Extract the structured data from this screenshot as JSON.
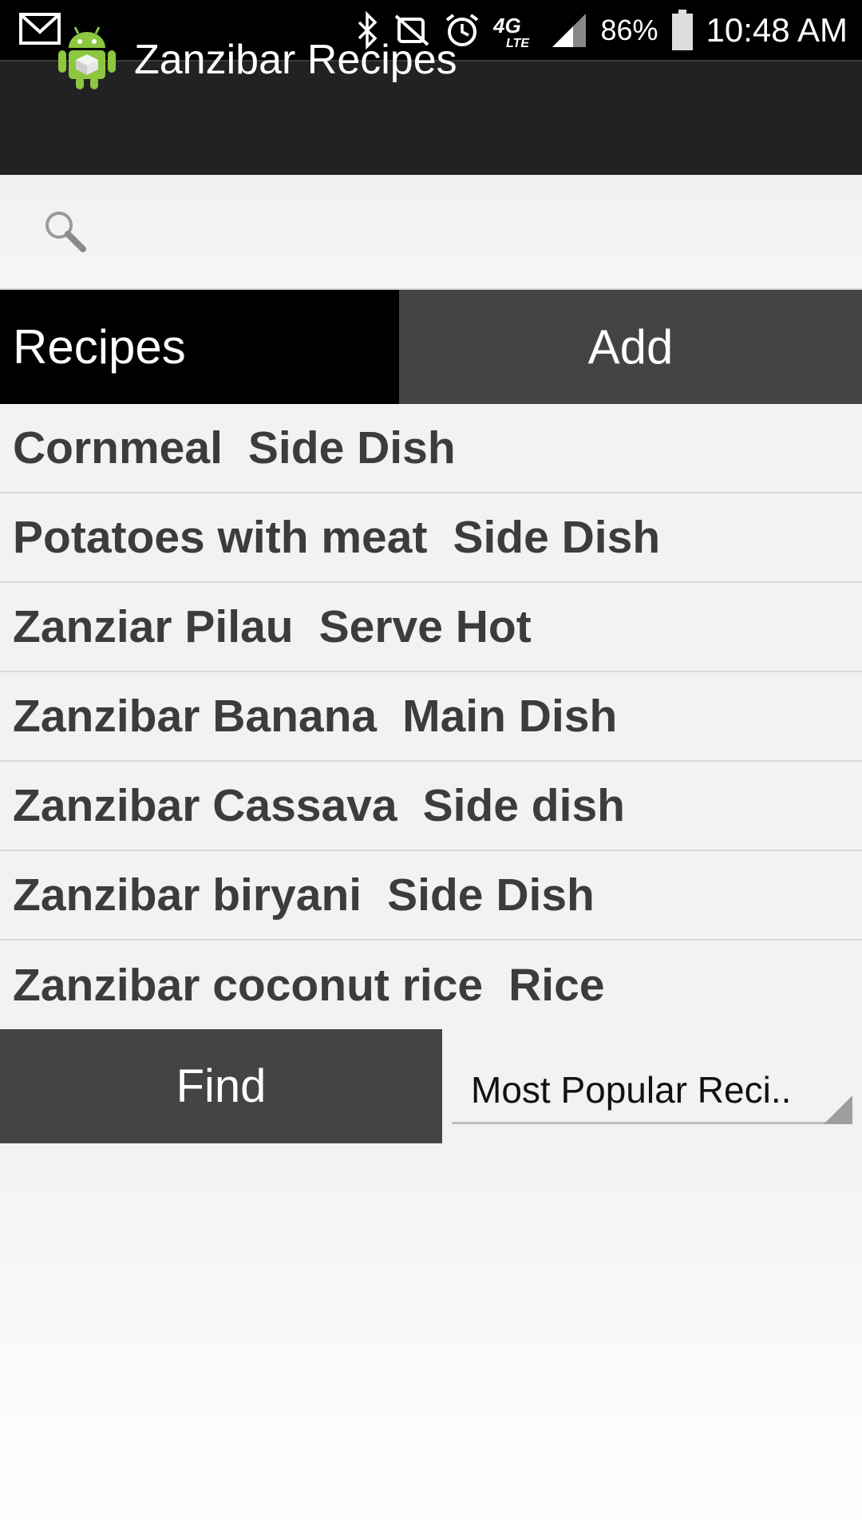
{
  "status_bar": {
    "battery": "86%",
    "time": "10:48 AM",
    "icons": [
      "gmail-icon",
      "bluetooth-icon",
      "mute-icon",
      "alarm-icon",
      "lte-icon",
      "signal-icon",
      "battery-icon"
    ],
    "network": "4G LTE"
  },
  "action_bar": {
    "title": "Zanzibar Recipes",
    "icon": "android-icon"
  },
  "search": {
    "value": "",
    "placeholder": ""
  },
  "tabs": {
    "recipes_label": "Recipes",
    "add_label": "Add"
  },
  "recipes": [
    {
      "name": "Cornmeal",
      "category": "Side Dish"
    },
    {
      "name": "Potatoes with meat",
      "category": "Side Dish"
    },
    {
      "name": "Zanziar Pilau",
      "category": "Serve Hot"
    },
    {
      "name": "Zanzibar Banana",
      "category": "Main Dish"
    },
    {
      "name": "Zanzibar Cassava",
      "category": "Side dish"
    },
    {
      "name": "Zanzibar biryani",
      "category": "Side Dish"
    },
    {
      "name": "Zanzibar coconut rice",
      "category": "Rice"
    }
  ],
  "controls": {
    "find_label": "Find",
    "sort_selected": "Most Popular Reci.."
  },
  "colors": {
    "status_bar": "#000000",
    "action_bar": "#222222",
    "tab_active": "#000000",
    "tab_inactive": "#444444",
    "list_bg": "#f2f2f2",
    "list_text": "#3c3c3c"
  }
}
